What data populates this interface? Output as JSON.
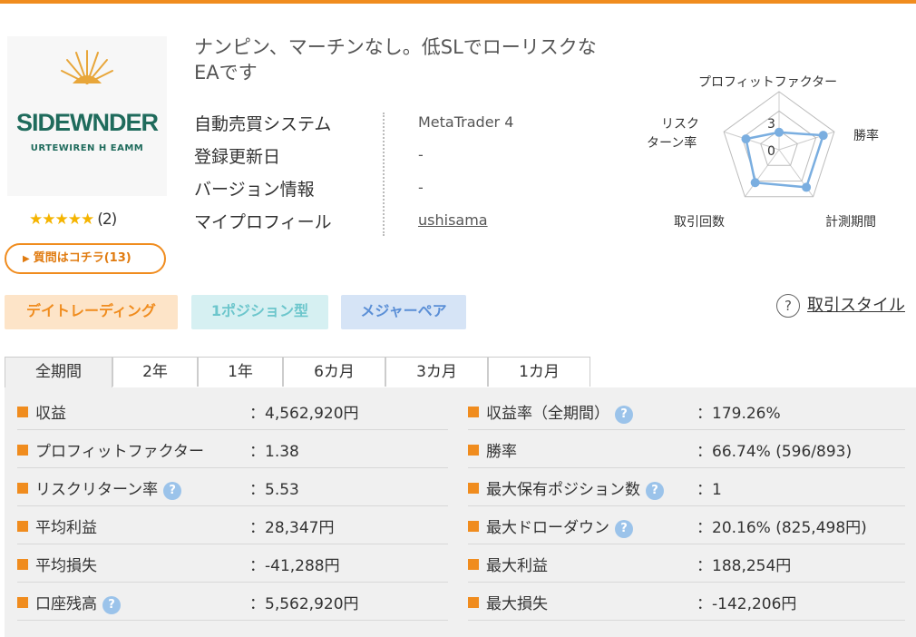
{
  "product": {
    "logo": {
      "name": "SIDEWNDER",
      "sub": "URTEWIREN H EAMM"
    },
    "rating": {
      "stars": "★★★★★",
      "count": "(2)"
    },
    "question_button": "質問はコチラ(13)",
    "title": "ナンピン、マーチンなし。低SLでローリスクなEAです"
  },
  "info": [
    {
      "label": "自動売買システム",
      "value": "MetaTrader 4"
    },
    {
      "label": "登録更新日",
      "value": "-"
    },
    {
      "label": "バージョン情報",
      "value": "-"
    },
    {
      "label": "マイプロフィール",
      "value": "ushisama"
    }
  ],
  "radar": {
    "labels": {
      "pf": "プロフィットファクター",
      "winrate": "勝率",
      "period": "計測期間",
      "trades": "取引回数",
      "riskreturn_1": "リスク",
      "riskreturn_2": "ターン率"
    },
    "scale": {
      "max": "3",
      "min": "0"
    },
    "values": {
      "pf": 0.3,
      "winrate": 0.8,
      "period": 0.8,
      "trades": 0.7,
      "riskreturn": 0.6
    },
    "color": "#7aaee0"
  },
  "tags": [
    {
      "label": "デイトレーディング",
      "bg": "#fde4c8",
      "fg": "#f08c1e"
    },
    {
      "label": "1ポジション型",
      "bg": "#d6f0f2",
      "fg": "#6cc6cc"
    },
    {
      "label": "メジャーペア",
      "bg": "#d6e4f6",
      "fg": "#5b8fd6"
    }
  ],
  "style_link": {
    "icon": "?",
    "label": "取引スタイル"
  },
  "tabs": [
    "全期間",
    "2年",
    "1年",
    "6カ月",
    "3カ月",
    "1カ月"
  ],
  "stats_left": [
    {
      "key": "収益",
      "value": "：4,562,920円",
      "help": false
    },
    {
      "key": "プロフィットファクター",
      "value": "：1.38",
      "help": false
    },
    {
      "key": "リスクリターン率",
      "value": "：5.53",
      "help": true
    },
    {
      "key": "平均利益",
      "value": "：28,347円",
      "help": false
    },
    {
      "key": "平均損失",
      "value": "：-41,288円",
      "help": false
    },
    {
      "key": "口座残高",
      "value": "：5,562,920円",
      "help": true
    }
  ],
  "stats_right": [
    {
      "key": "収益率（全期間）",
      "value": "：179.26%",
      "help": true
    },
    {
      "key": "勝率",
      "value": "：66.74% (596/893)",
      "help": false
    },
    {
      "key": "最大保有ポジション数",
      "value": "：1",
      "help": true
    },
    {
      "key": "最大ドローダウン",
      "value": "：20.16% (825,498円)",
      "help": true
    },
    {
      "key": "最大利益",
      "value": "：188,254円",
      "help": false
    },
    {
      "key": "最大損失",
      "value": "：-142,206円",
      "help": false
    }
  ],
  "help_icon": "?"
}
